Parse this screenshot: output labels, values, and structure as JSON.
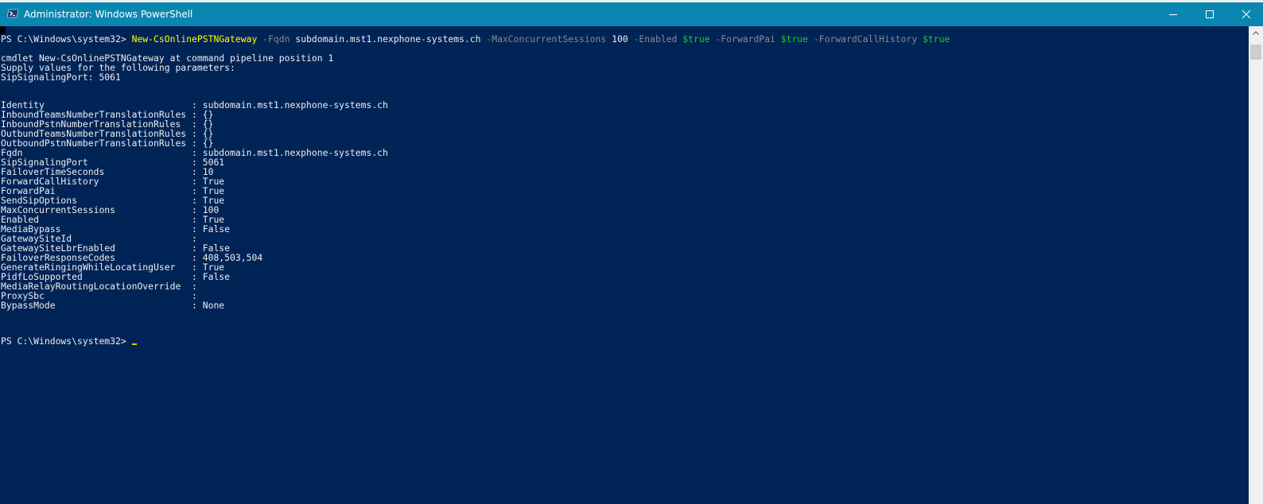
{
  "window": {
    "title": "Administrator: Windows PowerShell"
  },
  "colors": {
    "console_bg": "#012456",
    "titlebar_bg": "#0a87b0",
    "command": "#ffff00",
    "parameter": "#8a8a8a",
    "boolean": "#13d613",
    "text": "#eeedf0"
  },
  "icons": {
    "app": "powershell-icon",
    "minimize": "minimize-icon",
    "maximize": "maximize-icon",
    "close": "close-icon",
    "scroll_up": "scroll-up-arrow-icon"
  },
  "command": {
    "prompt": "PS C:\\Windows\\system32> ",
    "cmdlet": "New-CsOnlinePSTNGateway",
    "p_fqdn": " -Fqdn",
    "v_fqdn": " subdomain.mst1.nexphone-systems.ch",
    "p_maxsessions": " -MaxConcurrentSessions",
    "v_maxsessions": " 100",
    "p_enabled": " -Enabled",
    "v_enabled": " $true",
    "p_forwardpai": " -ForwardPai",
    "v_forwardpai": " $true",
    "p_forwardcall": " -ForwardCallHistory",
    "v_forwardcall": " $true"
  },
  "supply_lines": [
    "cmdlet New-CsOnlinePSTNGateway at command pipeline position 1",
    "Supply values for the following parameters:",
    "SipSignalingPort: 5061"
  ],
  "output": [
    "Identity                           : subdomain.mst1.nexphone-systems.ch",
    "InboundTeamsNumberTranslationRules : {}",
    "InboundPstnNumberTranslationRules  : {}",
    "OutbundTeamsNumberTranslationRules : {}",
    "OutboundPstnNumberTranslationRules : {}",
    "Fqdn                               : subdomain.mst1.nexphone-systems.ch",
    "SipSignalingPort                   : 5061",
    "FailoverTimeSeconds                : 10",
    "ForwardCallHistory                 : True",
    "ForwardPai                         : True",
    "SendSipOptions                     : True",
    "MaxConcurrentSessions              : 100",
    "Enabled                            : True",
    "MediaBypass                        : False",
    "GatewaySiteId                      :",
    "GatewaySiteLbrEnabled              : False",
    "FailoverResponseCodes              : 408,503,504",
    "GenerateRingingWhileLocatingUser   : True",
    "PidfLoSupported                    : False",
    "MediaRelayRoutingLocationOverride  :",
    "ProxySbc                           :",
    "BypassMode                         : None"
  ],
  "final_prompt": "PS C:\\Windows\\system32> "
}
